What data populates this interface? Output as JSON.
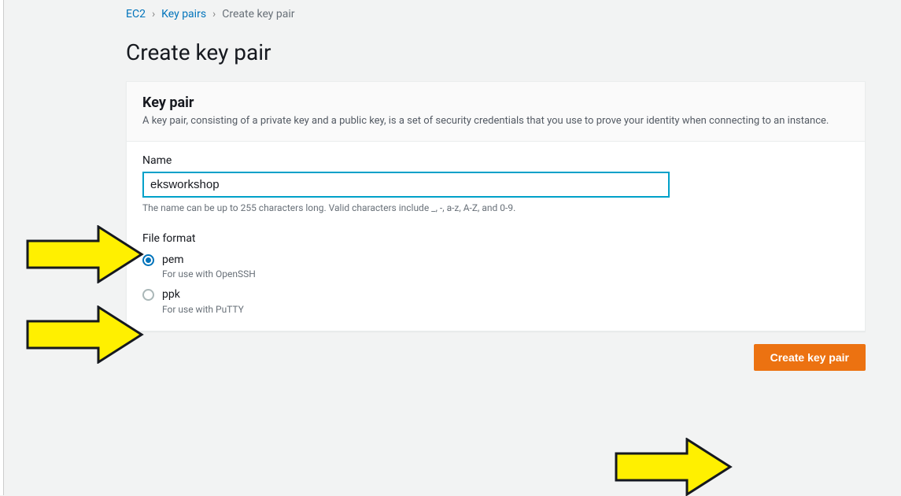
{
  "breadcrumb": {
    "items": [
      {
        "label": "EC2"
      },
      {
        "label": "Key pairs"
      }
    ],
    "current": "Create key pair"
  },
  "page_title": "Create key pair",
  "panel": {
    "title": "Key pair",
    "description": "A key pair, consisting of a private key and a public key, is a set of security credentials that you use to prove your identity when connecting to an instance."
  },
  "name_field": {
    "label": "Name",
    "value": "eksworkshop",
    "help": "The name can be up to 255 characters long. Valid characters include _, -, a-z, A-Z, and 0-9."
  },
  "file_format": {
    "label": "File format",
    "options": [
      {
        "value": "pem",
        "label": "pem",
        "desc": "For use with OpenSSH",
        "selected": true
      },
      {
        "value": "ppk",
        "label": "ppk",
        "desc": "For use with PuTTY",
        "selected": false
      }
    ]
  },
  "actions": {
    "create": "Create key pair"
  },
  "annotations": {
    "arrow_color": "#fff000",
    "arrow_stroke": "#16191f"
  }
}
